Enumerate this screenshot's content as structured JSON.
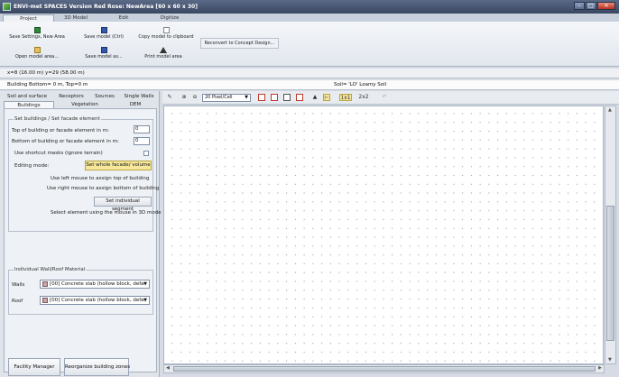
{
  "window": {
    "title": "ENVI-met SPACES Version Red Rose: NewArea [60 x 60 x 30]",
    "minimize": "–",
    "maximize": "□",
    "close": "✕"
  },
  "main_tabs": [
    "Project",
    "3D Model",
    "Edit",
    "Digitize"
  ],
  "ribbon": {
    "save_settings": "Save Settings, New Area",
    "open_model": "Open model area...",
    "save_model": "Save model (Ctrl)",
    "save_model_as": "Save model as...",
    "copy_model": "Copy model to clipboard",
    "print_model": "Print model area",
    "reconvert": "Reconvert to Concept Design..."
  },
  "coords": "x=8 (16.00 m) y=29 (58.00 m)",
  "info": {
    "left": "Building Bottom= 0 m, Top=0 m",
    "right": "Soil= 'LO' Loamy Soil"
  },
  "panel_tabs_top": [
    "Soil and surface",
    "Receptors",
    "Sources",
    "Single Walls"
  ],
  "panel_tabs_bottom": [
    "Buildings",
    "Vegetation",
    "DEM"
  ],
  "buildings": {
    "group_title": "Set buildings / Set facade element",
    "top_label": "Top of building or facade element in m:",
    "top_value": "0",
    "bottom_label": "Bottom of building or facade element in m:",
    "bottom_value": "0",
    "shortcut_label": "Use shortcut masks (ignore terrain)",
    "editing_label": "Editing mode:",
    "editing_value": "Set whole facade/ volume",
    "hint_left": "Use left mouse to assign top of building",
    "hint_right": "Use right mouse to assign bottom of building",
    "segment_button": "Set individual segment",
    "select_hint": "Select element using the mouse in 3D mode"
  },
  "materials": {
    "group_title": "Individual Wall/Roof Material",
    "walls_label": "Walls",
    "walls_value": "[00] Concrete slab (hollow block, defa",
    "roof_label": "Roof",
    "roof_value": "[00] Concrete slab (hollow block, defa"
  },
  "bottom_buttons": {
    "facility": "Facility Manager",
    "reorganize": "Reorganize building zones"
  },
  "toolbar": {
    "zoom_select": "20 Pixel/Cell",
    "mode_1": "1x1",
    "mode_2": "2x2"
  },
  "colors": {
    "accent_yellow": "#f6e79b",
    "title_bar": "#3a4763",
    "canvas": "#ffffff"
  }
}
